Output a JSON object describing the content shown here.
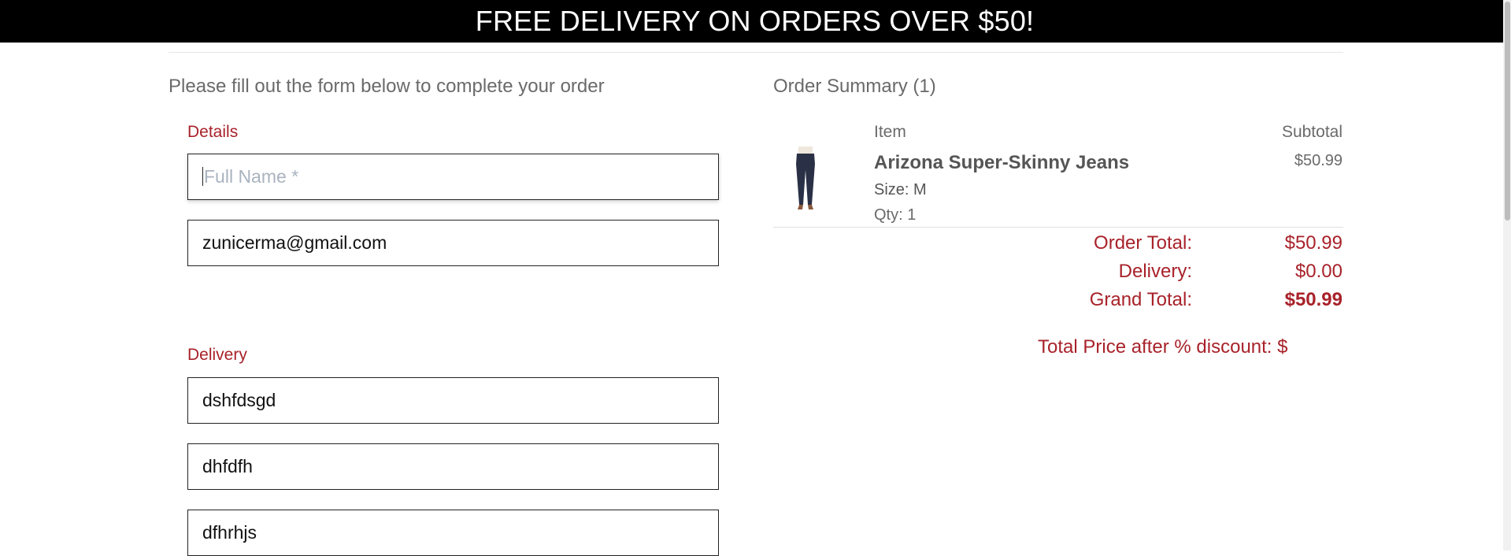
{
  "banner": {
    "text": "FREE DELIVERY ON ORDERS OVER $50!"
  },
  "form": {
    "intro": "Please fill out the form below to complete your order",
    "details": {
      "label": "Details",
      "full_name": {
        "placeholder": "Full Name *",
        "value": ""
      },
      "email": {
        "value": "zunicerma@gmail.com"
      }
    },
    "delivery": {
      "label": "Delivery",
      "fields": [
        "dshfdsgd",
        "dhfdfh",
        "dfhrhjs"
      ]
    }
  },
  "summary": {
    "title": "Order Summary (1)",
    "headers": {
      "item": "Item",
      "subtotal": "Subtotal"
    },
    "items": [
      {
        "name": "Arizona Super-Skinny Jeans",
        "size": "Size: M",
        "qty": "Qty: 1",
        "price": "$50.99"
      }
    ],
    "totals": {
      "order_total_label": "Order Total:",
      "order_total": "$50.99",
      "delivery_label": "Delivery:",
      "delivery": "$0.00",
      "grand_total_label": "Grand Total:",
      "grand_total": "$50.99"
    },
    "discount_text": "Total Price after % discount: $"
  },
  "colors": {
    "accent": "#a8222a",
    "banner_bg": "#000000"
  },
  "icons": {
    "product_image": "jeans-product-image"
  }
}
